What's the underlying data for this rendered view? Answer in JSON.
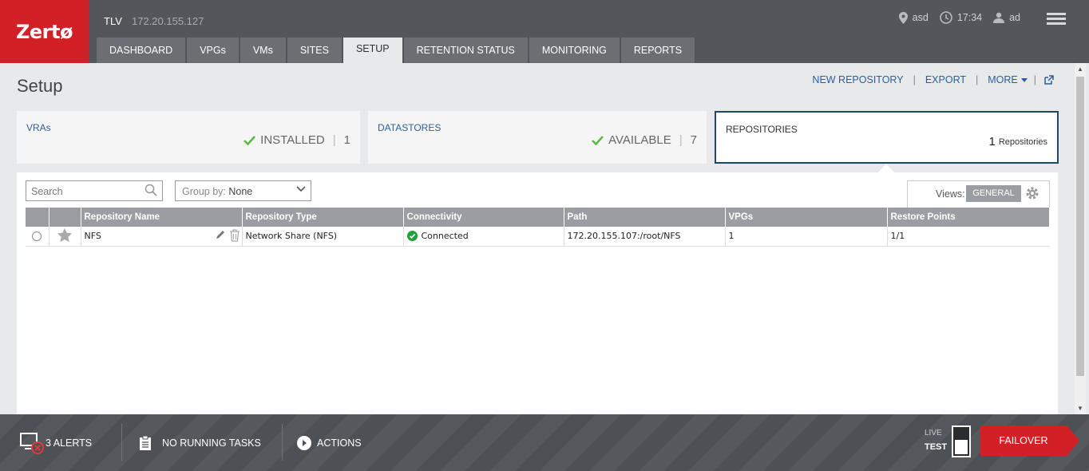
{
  "header": {
    "logo": "Zertø",
    "site_name": "TLV",
    "site_ip": "172.20.155.127",
    "tabs": [
      {
        "label": "DASHBOARD"
      },
      {
        "label": "VPGs"
      },
      {
        "label": "VMs"
      },
      {
        "label": "SITES"
      },
      {
        "label": "SETUP",
        "active": true
      },
      {
        "label": "RETENTION STATUS"
      },
      {
        "label": "MONITORING"
      },
      {
        "label": "REPORTS"
      }
    ],
    "location": "asd",
    "time": "17:34",
    "user": "ad"
  },
  "page": {
    "title": "Setup",
    "actions": {
      "new_repository": "NEW REPOSITORY",
      "export": "EXPORT",
      "more": "MORE"
    }
  },
  "cards": {
    "vras": {
      "title": "VRAs",
      "status": "INSTALLED",
      "count": "1"
    },
    "datastores": {
      "title": "DATASTORES",
      "status": "AVAILABLE",
      "count": "7"
    },
    "repositories": {
      "title": "REPOSITORIES",
      "count": "1",
      "unit": "Repositories"
    }
  },
  "toolbar": {
    "search_placeholder": "Search",
    "group_by_label": "Group by:",
    "group_by_value": "None",
    "views_label": "Views:",
    "views_value": "GENERAL"
  },
  "table": {
    "columns": [
      "Repository Name",
      "Repository Type",
      "Connectivity",
      "Path",
      "VPGs",
      "Restore Points"
    ],
    "rows": [
      {
        "name": "NFS",
        "type": "Network Share (NFS)",
        "connectivity": "Connected",
        "path": "172.20.155.107:/root/NFS",
        "vpgs": "1",
        "restore_points": "1/1"
      }
    ]
  },
  "footer": {
    "alerts": "3 ALERTS",
    "tasks": "NO RUNNING TASKS",
    "actions": "ACTIONS",
    "live": "LIVE",
    "test": "TEST",
    "failover": "FAILOVER"
  },
  "colors": {
    "brand_red": "#d31f26",
    "header_bg": "#53565b",
    "link_blue": "#2b5f9a",
    "connected_green": "#1fa03c"
  }
}
